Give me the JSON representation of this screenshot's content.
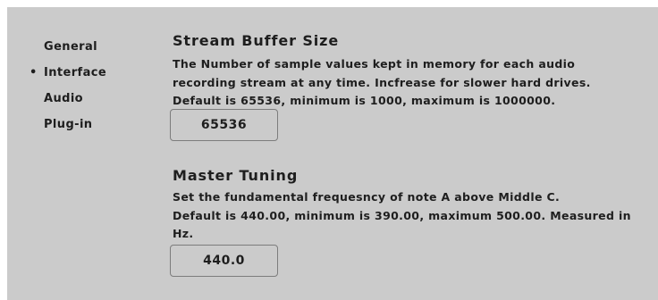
{
  "sidebar": {
    "items": [
      {
        "label": "General",
        "active": false
      },
      {
        "label": "Interface",
        "active": true
      },
      {
        "label": "Audio",
        "active": false
      },
      {
        "label": "Plug-in",
        "active": false
      }
    ],
    "active_marker": "•"
  },
  "sections": {
    "stream_buffer": {
      "title": "Stream Buffer Size",
      "lines": [
        "The Number of sample values kept in memory for each audio",
        "recording stream at any time. Incfrease for slower hard drives.",
        "Default is 65536, minimum is 1000, maximum is 1000000."
      ],
      "value": "65536"
    },
    "master_tuning": {
      "title": "Master Tuning",
      "lines": [
        "Set the fundamental frequesncy of note A above Middle C.",
        "Default is 440.00, minimum is 390.00, maximum 500.00. Measured in",
        "Hz."
      ],
      "value": "440.0"
    }
  },
  "colors": {
    "panel_background": "#cbcbcb",
    "text": "#1e1e1e",
    "field_border": "#7c7c7c"
  }
}
